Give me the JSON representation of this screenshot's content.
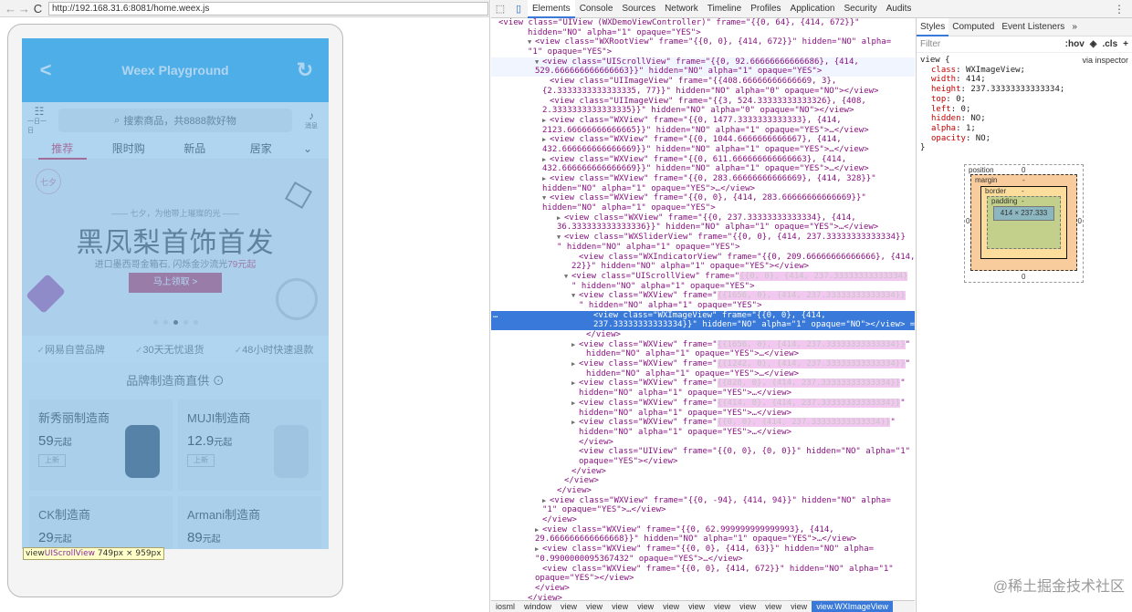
{
  "browser": {
    "url": "http://192.168.31.6:8081/home.weex.js"
  },
  "app": {
    "title": "Weex Playground",
    "mini_left": "一日一日",
    "search_placeholder": "搜索商品，共8888款好物",
    "mini_right": "消息",
    "tabs": [
      "推荐",
      "限时购",
      "新品",
      "居家"
    ],
    "banner": {
      "tag": "七夕",
      "slogan": "—— 七夕，为他带上璀璨的光 ——",
      "title": "黑凤梨首饰首发",
      "sub_prefix": "进口墨西哥金箱石, 闪烁金沙流光",
      "sub_price": "79元起",
      "cta": "马上领取 >"
    },
    "promises": [
      "网易自营品牌",
      "30天无忧退货",
      "48小时快速退款"
    ],
    "brand_title": "品牌制造商直供 ⊙",
    "cards": [
      {
        "name": "新秀丽制造商",
        "price": "59",
        "unit": "元起",
        "badge": "上新"
      },
      {
        "name": "MUJI制造商",
        "price": "12.9",
        "unit": "元起",
        "badge": "上新"
      },
      {
        "name": "CK制造商",
        "price": "29",
        "unit": "元起",
        "badge": ""
      },
      {
        "name": "Armani制造商",
        "price": "89",
        "unit": "元起",
        "badge": ""
      }
    ],
    "inspect_label": {
      "tag": "view",
      "cls": "UIScrollView",
      "size": "749px × 959px"
    }
  },
  "devtools": {
    "tabs": [
      "Elements",
      "Console",
      "Sources",
      "Network",
      "Timeline",
      "Profiles",
      "Application",
      "Security",
      "Audits"
    ],
    "breadcrumbs": [
      "iosml",
      "window",
      "view",
      "view",
      "view",
      "view",
      "view",
      "view",
      "view",
      "view",
      "view",
      "view",
      "view.WXImageView"
    ],
    "sidebar_tabs": [
      "Styles",
      "Computed",
      "Event Listeners"
    ],
    "filter_placeholder": "Filter",
    "filter_hov": ":hov",
    "filter_cls": ".cls",
    "rule_selector": "view {",
    "rule_via": "via inspector",
    "rule_props": [
      {
        "name": "class",
        "value": "WXImageView;"
      },
      {
        "name": "width",
        "value": "414;"
      },
      {
        "name": "height",
        "value": "237.33333333333334;"
      },
      {
        "name": "top",
        "value": "0;"
      },
      {
        "name": "left",
        "value": "0;"
      },
      {
        "name": "hidden",
        "value": "NO;"
      },
      {
        "name": "alpha",
        "value": "1;"
      },
      {
        "name": "opacity",
        "value": "NO;"
      }
    ],
    "rule_close": "}",
    "boxmodel": {
      "position": "position",
      "position_val": "0",
      "margin": "margin",
      "margin_val": "-",
      "border": "border",
      "border_val": "-",
      "padding": "padding",
      "padding_val": "-",
      "content": "414 × 237.333",
      "left_val": "0",
      "right_val": "0",
      "bottom_val": "0"
    },
    "watermark": "@稀土掘金技术社区",
    "lines": [
      {
        "indent": 0,
        "twisty": "",
        "text": "<view class=\"UIView (WXDemoViewController)\" frame=\"{{0, 64}, {414, 672}}\"",
        "cls": ""
      },
      {
        "indent": 5,
        "twisty": "",
        "text": "hidden=\"NO\" alpha=\"1\" opaque=\"YES\">",
        "cls": ""
      },
      {
        "indent": 6,
        "twisty": "▼",
        "text": "<view class=\"WXRootView\" frame=\"{{0, 0}, {414, 672}}\" hidden=\"NO\" alpha=",
        "cls": ""
      },
      {
        "indent": 5,
        "twisty": "",
        "text": "\"1\" opaque=\"YES\">",
        "cls": ""
      },
      {
        "indent": 7,
        "twisty": "▼",
        "text": "<view class=\"UIScrollView\" frame=\"{{0, 92.66666666666686}, {414,",
        "cls": "hl"
      },
      {
        "indent": 6,
        "twisty": "",
        "text": "529.666666666666663}}\" hidden=\"NO\" alpha=\"1\" opaque=\"YES\">",
        "cls": "hl"
      },
      {
        "indent": 8,
        "twisty": "",
        "text": "<view class=\"UIImageView\" frame=\"{{408.66666666666669, 3},",
        "cls": ""
      },
      {
        "indent": 7,
        "twisty": "",
        "text": "{2.3333333333333335, 77}}\" hidden=\"NO\" alpha=\"0\" opaque=\"NO\"></view>",
        "cls": ""
      },
      {
        "indent": 8,
        "twisty": "",
        "text": "<view class=\"UIImageView\" frame=\"{{3, 524.33333333333326}, {408,",
        "cls": ""
      },
      {
        "indent": 7,
        "twisty": "",
        "text": "2.3333333333333335}}\" hidden=\"NO\" alpha=\"0\" opaque=\"NO\"></view>",
        "cls": ""
      },
      {
        "indent": 8,
        "twisty": "▶",
        "text": "<view class=\"WXView\" frame=\"{{0, 1477.3333333333333}, {414,",
        "cls": ""
      },
      {
        "indent": 7,
        "twisty": "",
        "text": "2123.66666666666665}}\" hidden=\"NO\" alpha=\"1\" opaque=\"YES\">…</view>",
        "cls": ""
      },
      {
        "indent": 8,
        "twisty": "▶",
        "text": "<view class=\"WXView\" frame=\"{{0, 1044.6666666666667}, {414,",
        "cls": ""
      },
      {
        "indent": 7,
        "twisty": "",
        "text": "432.666666666666669}}\" hidden=\"NO\" alpha=\"1\" opaque=\"YES\">…</view>",
        "cls": ""
      },
      {
        "indent": 8,
        "twisty": "▶",
        "text": "<view class=\"WXView\" frame=\"{{0, 611.666666666666663}, {414,",
        "cls": ""
      },
      {
        "indent": 7,
        "twisty": "",
        "text": "432.666666666666669}}\" hidden=\"NO\" alpha=\"1\" opaque=\"YES\">…</view>",
        "cls": ""
      },
      {
        "indent": 8,
        "twisty": "▶",
        "text": "<view class=\"WXView\" frame=\"{{0, 283.66666666666669}, {414, 328}}\"",
        "cls": ""
      },
      {
        "indent": 7,
        "twisty": "",
        "text": "hidden=\"NO\" alpha=\"1\" opaque=\"YES\">…</view>",
        "cls": ""
      },
      {
        "indent": 8,
        "twisty": "▼",
        "text": "<view class=\"WXView\" frame=\"{{0, 0}, {414, 283.66666666666669}}\"",
        "cls": ""
      },
      {
        "indent": 7,
        "twisty": "",
        "text": "hidden=\"NO\" alpha=\"1\" opaque=\"YES\">",
        "cls": ""
      },
      {
        "indent": 10,
        "twisty": "▶",
        "text": "<view class=\"WXView\" frame=\"{{0, 237.33333333333334}, {414,",
        "cls": ""
      },
      {
        "indent": 9,
        "twisty": "",
        "text": "36.333333333333336}}\" hidden=\"NO\" alpha=\"1\" opaque=\"YES\">…</view>",
        "cls": ""
      },
      {
        "indent": 10,
        "twisty": "▼",
        "text": "<view class=\"WXSliderView\" frame=\"{{0, 0}, {414, 237.33333333333334}}",
        "cls": ""
      },
      {
        "indent": 9,
        "twisty": "",
        "text": "\" hidden=\"NO\" alpha=\"1\" opaque=\"YES\">",
        "cls": ""
      },
      {
        "indent": 12,
        "twisty": "",
        "text": "<view class=\"WXIndicatorView\" frame=\"{{0, 209.66666666666666}, {414,",
        "cls": ""
      },
      {
        "indent": 11,
        "twisty": "",
        "text": "22}}\" hidden=\"NO\" alpha=\"1\" opaque=\"YES\"></view>",
        "cls": ""
      },
      {
        "indent": 11,
        "twisty": "▼",
        "text": "<view class=\"UIScrollView\" frame=\"{{0, 0}, {414, 237.33333333333334}",
        "cls": "pk"
      },
      {
        "indent": 11,
        "twisty": "",
        "text": "\" hidden=\"NO\" alpha=\"1\" opaque=\"YES\">",
        "cls": "pk"
      },
      {
        "indent": 12,
        "twisty": "▼",
        "text": "<view class=\"WXView\" frame=\"{{1656, 0}, {414, 237.33333333333334}}",
        "cls": "pk"
      },
      {
        "indent": 12,
        "twisty": "",
        "text": "\" hidden=\"NO\" alpha=\"1\" opaque=\"YES\">",
        "cls": ""
      },
      {
        "indent": 14,
        "twisty": "",
        "text": "<view class=\"WXImageView\" frame=\"{{0, 0}, {414,",
        "cls": "sel"
      },
      {
        "indent": 14,
        "twisty": "",
        "text": "237.33333333333334}}\" hidden=\"NO\" alpha=\"1\" opaque=\"NO\"></view> ==",
        "cls": "sel"
      },
      {
        "indent": 13,
        "twisty": "",
        "text": "</view>",
        "cls": ""
      },
      {
        "indent": 12,
        "twisty": "▶",
        "text": "<view class=\"WXView\" frame=\"{{1656, 0}, {414, 237.33333333333334}}\"",
        "cls": "pk"
      },
      {
        "indent": 13,
        "twisty": "",
        "text": "hidden=\"NO\" alpha=\"1\" opaque=\"YES\">…</view>",
        "cls": ""
      },
      {
        "indent": 12,
        "twisty": "▶",
        "text": "<view class=\"WXView\" frame=\"{{1242, 0}, {414, 237.33333333333334}}\"",
        "cls": "pk"
      },
      {
        "indent": 13,
        "twisty": "",
        "text": "hidden=\"NO\" alpha=\"1\" opaque=\"YES\">…</view>",
        "cls": ""
      },
      {
        "indent": 12,
        "twisty": "▶",
        "text": "<view class=\"WXView\" frame=\"{{828, 0}, {414, 237.33333333333334}}\"",
        "cls": "pk"
      },
      {
        "indent": 12,
        "twisty": "",
        "text": "hidden=\"NO\" alpha=\"1\" opaque=\"YES\">…</view>",
        "cls": ""
      },
      {
        "indent": 12,
        "twisty": "▶",
        "text": "<view class=\"WXView\" frame=\"{{414, 0}, {414, 237.33333333333334}}\"",
        "cls": "pk"
      },
      {
        "indent": 12,
        "twisty": "",
        "text": "hidden=\"NO\" alpha=\"1\" opaque=\"YES\">…</view>",
        "cls": ""
      },
      {
        "indent": 12,
        "twisty": "▶",
        "text": "<view class=\"WXView\" frame=\"{{0, 0}, {414, 237.33333333333334}}\"",
        "cls": "pk"
      },
      {
        "indent": 12,
        "twisty": "",
        "text": "hidden=\"NO\" alpha=\"1\" opaque=\"YES\">…</view>",
        "cls": ""
      },
      {
        "indent": 12,
        "twisty": "",
        "text": "</view>",
        "cls": ""
      },
      {
        "indent": 12,
        "twisty": "",
        "text": "<view class=\"UIView\" frame=\"{{0, 0}, {0, 0}}\" hidden=\"NO\" alpha=\"1\"",
        "cls": ""
      },
      {
        "indent": 12,
        "twisty": "",
        "text": "opaque=\"YES\"></view>",
        "cls": ""
      },
      {
        "indent": 11,
        "twisty": "",
        "text": "</view>",
        "cls": ""
      },
      {
        "indent": 10,
        "twisty": "",
        "text": "</view>",
        "cls": ""
      },
      {
        "indent": 9,
        "twisty": "",
        "text": "</view>",
        "cls": ""
      },
      {
        "indent": 8,
        "twisty": "▶",
        "text": "<view class=\"WXView\" frame=\"{{0, -94}, {414, 94}}\" hidden=\"NO\" alpha=",
        "cls": ""
      },
      {
        "indent": 7,
        "twisty": "",
        "text": "\"1\" opaque=\"YES\">…</view>",
        "cls": ""
      },
      {
        "indent": 7,
        "twisty": "",
        "text": "</view>",
        "cls": ""
      },
      {
        "indent": 7,
        "twisty": "▶",
        "text": "<view class=\"WXView\" frame=\"{{0, 62.999999999999993}, {414,",
        "cls": ""
      },
      {
        "indent": 6,
        "twisty": "",
        "text": "29.666666666666668}}\" hidden=\"NO\" alpha=\"1\" opaque=\"YES\">…</view>",
        "cls": ""
      },
      {
        "indent": 7,
        "twisty": "▶",
        "text": "<view class=\"WXView\" frame=\"{{0, 0}, {414, 63}}\" hidden=\"NO\" alpha=",
        "cls": ""
      },
      {
        "indent": 6,
        "twisty": "",
        "text": "\"0.9900000095367432\" opaque=\"YES\">…</view>",
        "cls": ""
      },
      {
        "indent": 7,
        "twisty": "",
        "text": "<view class=\"WXView\" frame=\"{{0, 0}, {414, 672}}\" hidden=\"NO\" alpha=\"1\"",
        "cls": ""
      },
      {
        "indent": 6,
        "twisty": "",
        "text": "opaque=\"YES\"></view>",
        "cls": ""
      },
      {
        "indent": 6,
        "twisty": "",
        "text": "</view>",
        "cls": ""
      },
      {
        "indent": 5,
        "twisty": "",
        "text": "</view>",
        "cls": ""
      },
      {
        "indent": 4,
        "twisty": "",
        "text": "</view>",
        "cls": ""
      }
    ]
  },
  "colors": {
    "app_header": "#26a8e8",
    "tab_active": "#e21a3d",
    "inspect_overlay": "#70b2e6",
    "selected_row": "#3879d9"
  }
}
